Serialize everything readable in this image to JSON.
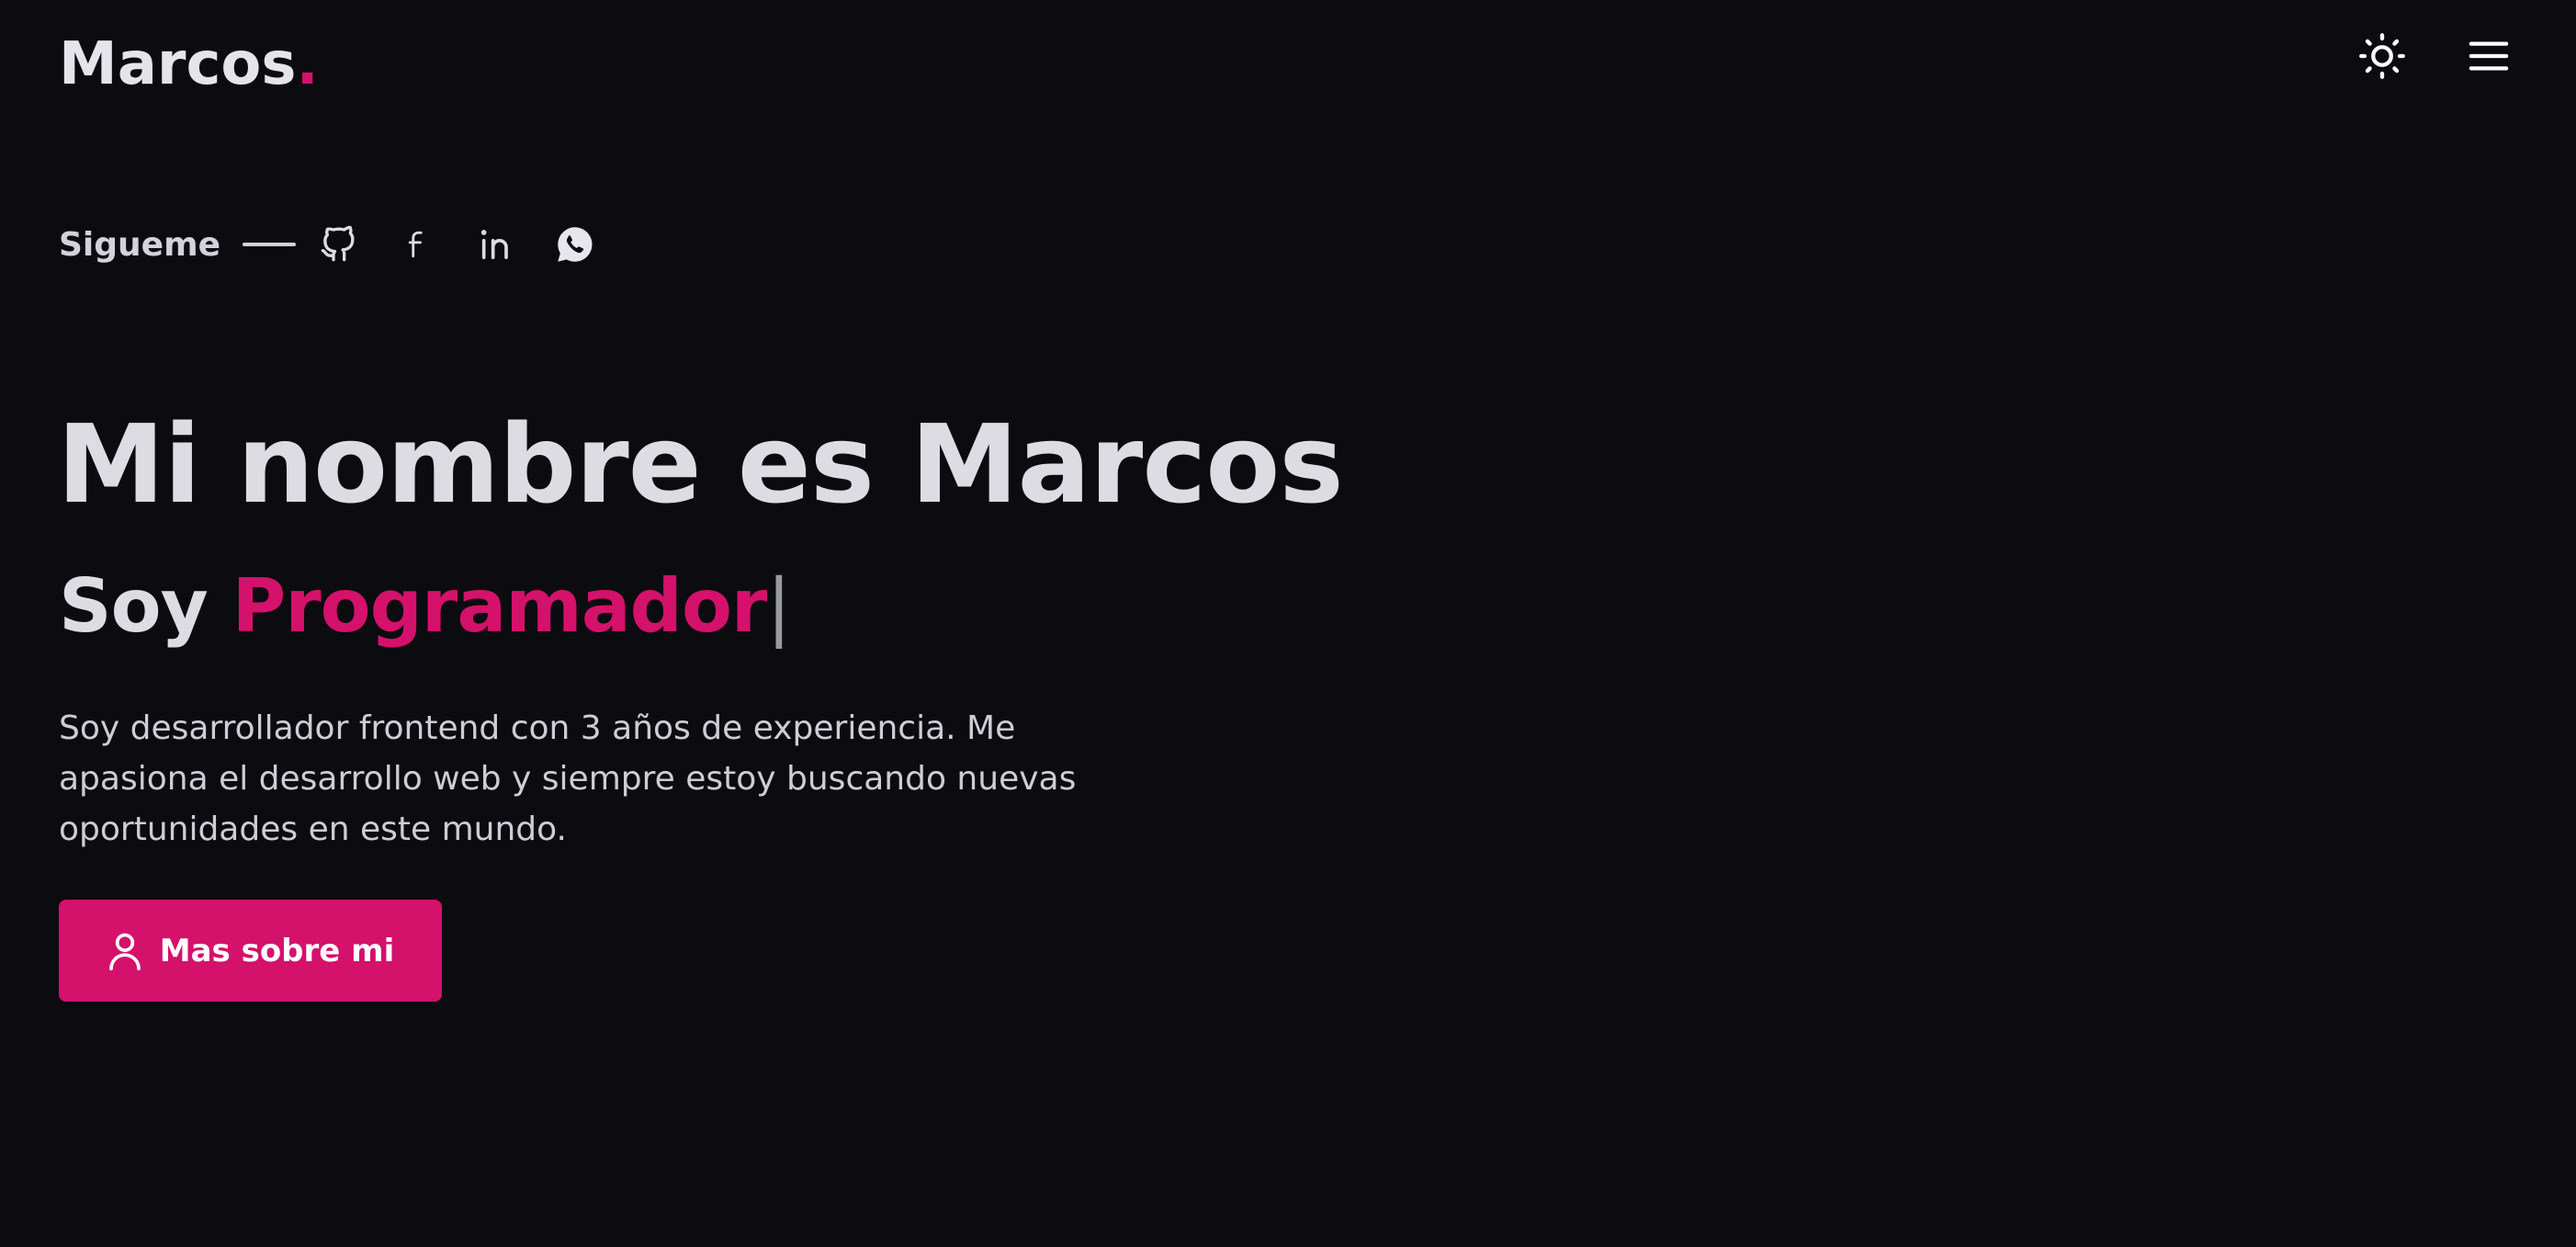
{
  "header": {
    "logo_text": "Marcos",
    "logo_dot": ".",
    "theme_toggle_icon": "sun-icon",
    "menu_icon": "hamburger-menu-icon"
  },
  "social": {
    "label": "Sigueme",
    "links": [
      {
        "name": "GitHub",
        "icon": "github-icon"
      },
      {
        "name": "Facebook",
        "icon": "facebook-icon"
      },
      {
        "name": "LinkedIn",
        "icon": "linkedin-icon"
      },
      {
        "name": "WhatsApp",
        "icon": "whatsapp-icon"
      }
    ]
  },
  "hero": {
    "title": "Mi nombre es Marcos",
    "subtitle_prefix": "Soy ",
    "subtitle_role": "Programador",
    "caret": "|",
    "description": "Soy desarrollador frontend con 3 años de experiencia. Me apasiona el desarrollo web y siempre estoy buscando nuevas oportunidades en este mundo."
  },
  "cta": {
    "label": "Mas sobre mi",
    "icon": "user-icon"
  },
  "colors": {
    "background": "#0b0b10",
    "accent": "#d4116b",
    "text": "#dcdce2"
  }
}
